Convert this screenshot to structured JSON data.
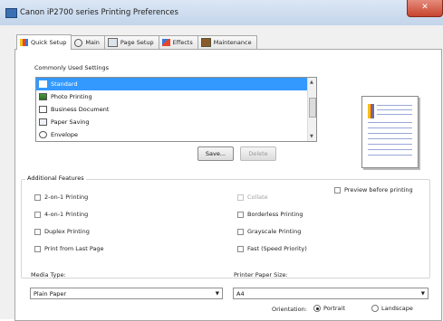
{
  "window": {
    "title": "Canon iP2700 series Printing Preferences",
    "close_glyph": "✕"
  },
  "tabs": [
    {
      "label": "Quick Setup",
      "icon": "quick-setup-icon"
    },
    {
      "label": "Main",
      "icon": "main-icon"
    },
    {
      "label": "Page Setup",
      "icon": "page-setup-icon"
    },
    {
      "label": "Effects",
      "icon": "effects-icon"
    },
    {
      "label": "Maintenance",
      "icon": "maintenance-icon"
    }
  ],
  "settings": {
    "label": "Commonly Used Settings",
    "items": [
      {
        "label": "Standard",
        "selected": true
      },
      {
        "label": "Photo Printing"
      },
      {
        "label": "Business Document"
      },
      {
        "label": "Paper Saving"
      },
      {
        "label": "Envelope"
      }
    ],
    "save_label": "Save...",
    "delete_label": "Delete"
  },
  "preview": {
    "checkbox_label": "Preview before printing",
    "checked": false
  },
  "features": {
    "title": "Additional Features",
    "left": [
      "2-on-1 Printing",
      "4-on-1 Printing",
      "Duplex Printing",
      "Print from Last Page"
    ],
    "right": [
      "Collate",
      "Borderless Printing",
      "Grayscale Printing",
      "Fast (Speed Priority)"
    ]
  },
  "media": {
    "label": "Media Type:",
    "value": "Plain Paper"
  },
  "paper": {
    "label": "Printer Paper Size:",
    "value": "A4"
  },
  "orientation": {
    "label": "Orientation:",
    "portrait": "Portrait",
    "landscape": "Landscape",
    "selected": "portrait"
  },
  "colors": {
    "selection": "#3399ff",
    "close": "#c7452f",
    "icon_yellow": "#f3c21a",
    "icon_red": "#e4472c",
    "icon_blue": "#3a78d8"
  }
}
